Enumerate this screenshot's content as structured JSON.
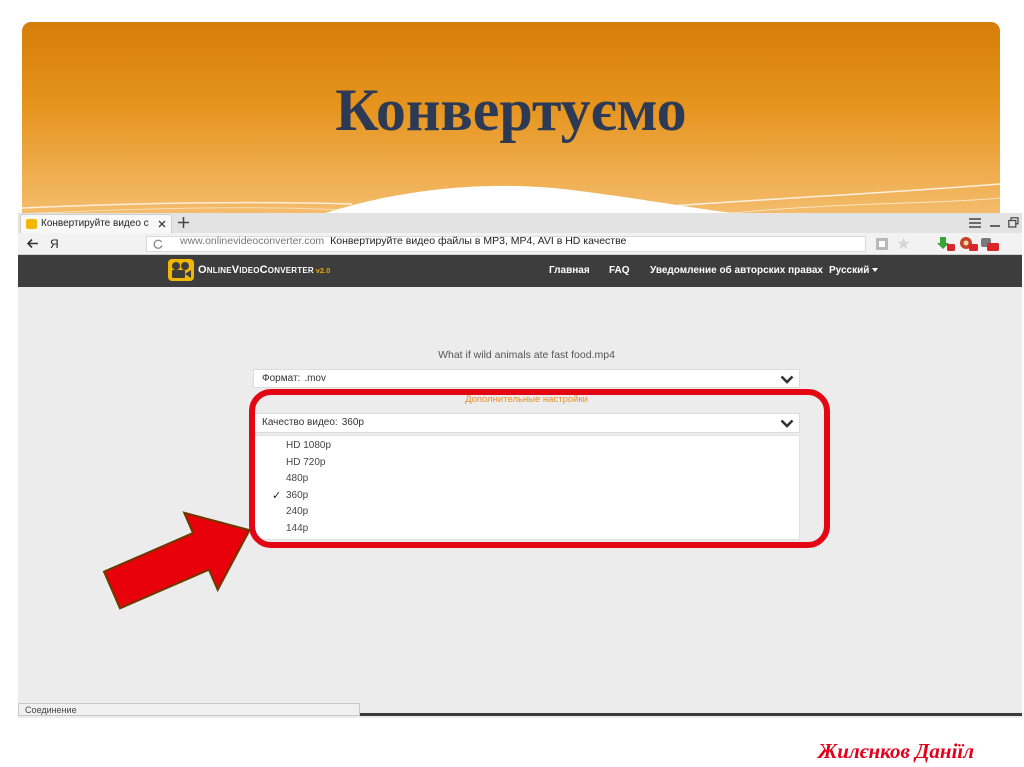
{
  "slide": {
    "title": "Конвертуємо",
    "author": "Жилєнков Даніїл"
  },
  "browser": {
    "tab": {
      "title": "Конвертируйте видео с",
      "icons": [
        "video-favicon-icon",
        "close-icon",
        "plus-icon"
      ]
    },
    "window_icons": [
      "menu-icon",
      "minimize-icon",
      "restore-icon"
    ],
    "toolbar": {
      "yandex": "Я",
      "domain": "www.onlinevideoconverter.com",
      "page_title": "Конвертируйте видео файлы в MP3, MP4, AVI в HD качестве",
      "icons": [
        "back-arrow-icon",
        "reload-icon",
        "reader-mode-icon",
        "bookmark-star-icon",
        "download-extension-icon",
        "security-extension-icon",
        "notifications-extension-icon"
      ]
    },
    "status": "Соединение"
  },
  "site": {
    "logo": {
      "name": "OnlineVideoConverter",
      "version": "v2.0",
      "icon": "film-camera-icon"
    },
    "nav": [
      "Главная",
      "FAQ",
      "Уведомление об авторских правах",
      "Русский"
    ],
    "filename": "What if wild animals ate fast food.mp4",
    "format": {
      "label": "Формат:",
      "value": ".mov"
    },
    "advanced_settings": "Дополнительные настройки",
    "quality": {
      "label": "Качество видео:",
      "value": "360p",
      "options": [
        "HD 1080p",
        "HD 720p",
        "480p",
        "360p",
        "240p",
        "144p"
      ],
      "check_mark": "✓"
    }
  },
  "colors": {
    "header_top": "#d57d08",
    "header_bottom": "#f4bc6c",
    "title": "#2c3a55",
    "navbar": "#3d3d3d",
    "content": "#ececec",
    "advanced": "#e8922a",
    "highlight": "#e30613",
    "arrow": "#e8000a",
    "author": "#e3001b"
  }
}
